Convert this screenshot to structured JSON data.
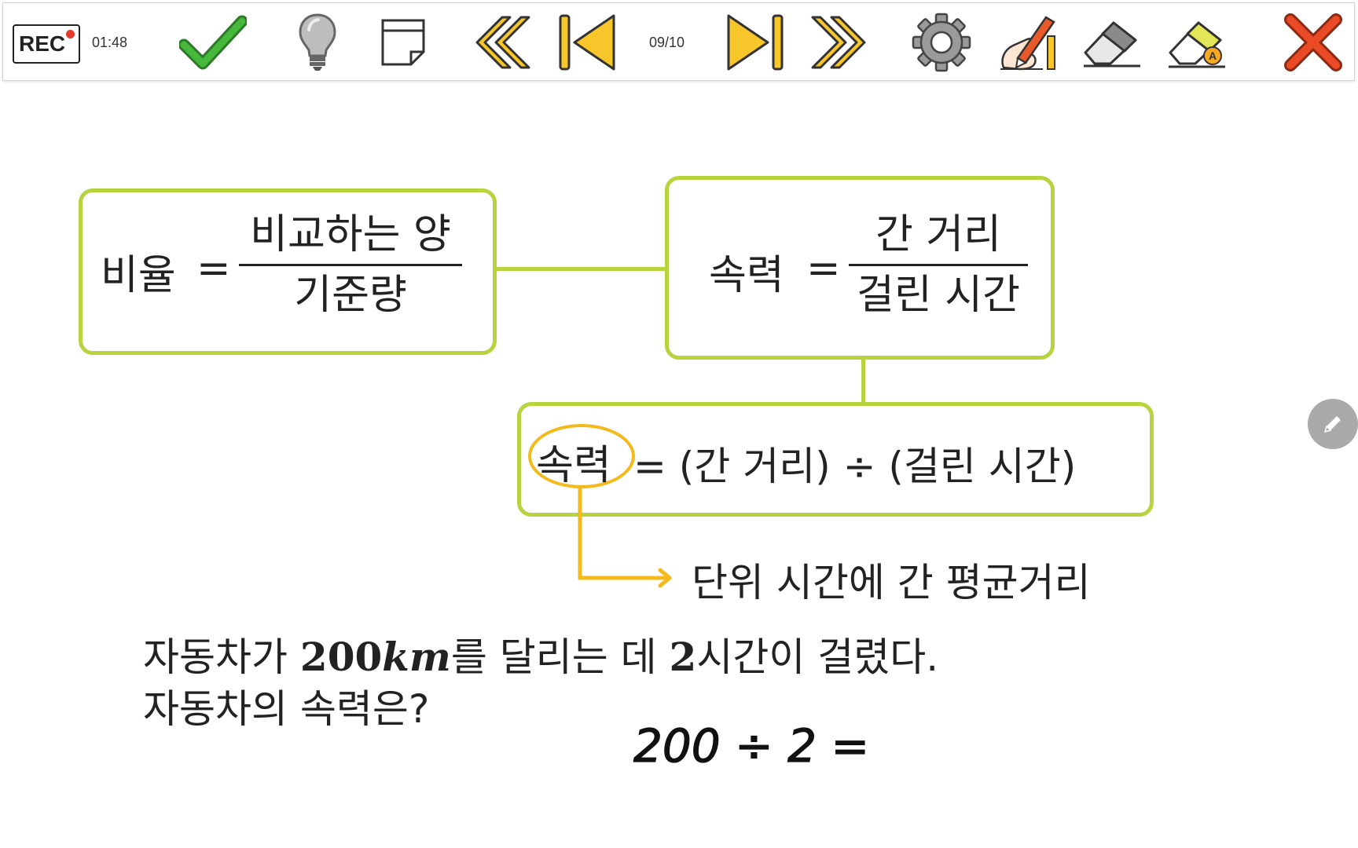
{
  "toolbar": {
    "rec_label": "REC",
    "elapsed_time": "01:48",
    "page_indicator": "09/10"
  },
  "diagram": {
    "ratio_box": {
      "lhs": "비율",
      "equals": "=",
      "numerator": "비교하는 양",
      "denominator": "기준량"
    },
    "speed_box": {
      "lhs": "속력",
      "equals": "=",
      "numerator": "간 거리",
      "denominator": "걸린 시간"
    },
    "formula_box": {
      "term": "속력",
      "expression": "= (간 거리) ÷ (걸린 시간)"
    },
    "annotation": "단위 시간에 간 평균거리"
  },
  "problem": {
    "line1_a": "자동차가 ",
    "distance_num": "200",
    "distance_unit": "km",
    "line1_b": "를 달리는 데 ",
    "hours_num": "2",
    "line1_c": "시간이 걸렸다.",
    "line2": "자동차의 속력은?"
  },
  "handwriting": {
    "text": "200 ÷ 2 ="
  },
  "colors": {
    "box_border": "#b7d43f",
    "highlight": "#f4b91a",
    "accent_red": "#e53a2b",
    "check_green": "#3aa534",
    "nav_yellow": "#f7c62b"
  }
}
